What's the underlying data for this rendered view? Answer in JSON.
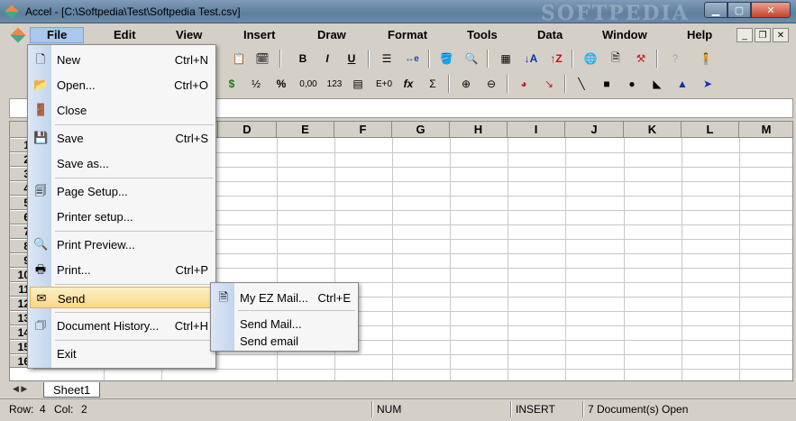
{
  "window": {
    "title": "Accel - [C:\\Softpedia\\Test\\Softpedia Test.csv]",
    "watermark": "SOFTPEDIA"
  },
  "menubar": {
    "items": [
      "File",
      "Edit",
      "View",
      "Insert",
      "Draw",
      "Format",
      "Tools",
      "Data",
      "Window",
      "Help"
    ]
  },
  "toolbar2": {
    "half": "½",
    "percent": "%",
    "decimals": "0,00",
    "numbers": "123",
    "exp": "E+0",
    "fx": "fx",
    "sum": "Σ"
  },
  "toolbar1": {
    "bold": "B",
    "italic": "I",
    "underline": "U"
  },
  "grid": {
    "columns": [
      "D",
      "E",
      "F",
      "G",
      "H",
      "I",
      "J",
      "K",
      "L",
      "M"
    ],
    "rows": [
      "1",
      "2",
      "3",
      "4",
      "5",
      "6",
      "7",
      "8",
      "9",
      "10",
      "11",
      "12",
      "13",
      "14",
      "15",
      "16"
    ]
  },
  "file_menu": {
    "items": [
      {
        "label": "New",
        "shortcut": "Ctrl+N",
        "icon": "new-file-icon"
      },
      {
        "label": "Open...",
        "shortcut": "Ctrl+O",
        "icon": "open-folder-icon"
      },
      {
        "label": "Close",
        "shortcut": "",
        "icon": "close-door-icon"
      },
      {
        "label": "Save",
        "shortcut": "Ctrl+S",
        "icon": "save-disk-icon"
      },
      {
        "label": "Save as...",
        "shortcut": "",
        "icon": ""
      },
      {
        "label": "Page Setup...",
        "shortcut": "",
        "icon": "page-setup-icon"
      },
      {
        "label": "Printer setup...",
        "shortcut": "",
        "icon": ""
      },
      {
        "label": "Print Preview...",
        "shortcut": "",
        "icon": "print-preview-icon"
      },
      {
        "label": "Print...",
        "shortcut": "Ctrl+P",
        "icon": "printer-icon"
      },
      {
        "label": "Send",
        "shortcut": "",
        "icon": "send-icon"
      },
      {
        "label": "Document History...",
        "shortcut": "Ctrl+H",
        "icon": "history-icon"
      },
      {
        "label": "Exit",
        "shortcut": "",
        "icon": ""
      }
    ]
  },
  "send_submenu": {
    "items": [
      {
        "label": "My EZ Mail...",
        "shortcut": "Ctrl+E"
      },
      {
        "label": "Send Mail...",
        "shortcut": ""
      },
      {
        "label": "Send email",
        "shortcut": ""
      }
    ]
  },
  "sheets": {
    "tab": "Sheet1"
  },
  "statusbar": {
    "row_label": "Row:",
    "row_value": "4",
    "col_label": "Col:",
    "col_value": "2",
    "num": "NUM",
    "insert": "INSERT",
    "documents": "7 Document(s) Open"
  }
}
